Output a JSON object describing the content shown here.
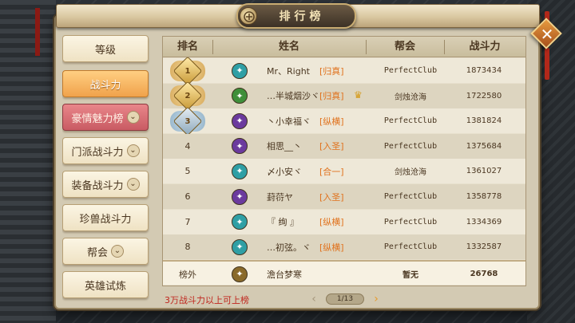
{
  "title": "排行榜",
  "tabs": [
    {
      "label": "等级",
      "state": "normal",
      "has_dropdown": false
    },
    {
      "label": "战斗力",
      "state": "active",
      "has_dropdown": false
    },
    {
      "label": "豪情魅力榜",
      "state": "sub",
      "has_dropdown": true
    },
    {
      "label": "门派战斗力",
      "state": "normal",
      "has_dropdown": true
    },
    {
      "label": "装备战斗力",
      "state": "normal",
      "has_dropdown": true
    },
    {
      "label": "珍兽战斗力",
      "state": "normal",
      "has_dropdown": false
    },
    {
      "label": "帮会",
      "state": "normal",
      "has_dropdown": true
    },
    {
      "label": "英雄试炼",
      "state": "normal",
      "has_dropdown": false
    }
  ],
  "columns": [
    "排名",
    "姓名",
    "帮会",
    "战斗力"
  ],
  "rows": [
    {
      "rank": "1",
      "medal": "gold",
      "icon": "teal",
      "name": "Mr、Right",
      "tag": "[归真]",
      "guild": "PerfectClub",
      "power": "1873434"
    },
    {
      "rank": "2",
      "medal": "gold",
      "icon": "green",
      "name": "…半城烟沙ヾ",
      "tag": "[归真]",
      "guild": "剑烛沧海",
      "power": "1722580",
      "crown": true
    },
    {
      "rank": "3",
      "medal": "silver",
      "icon": "purple",
      "name": "丶小幸福ヾ",
      "tag": "[纵横]",
      "guild": "PerfectClub",
      "power": "1381824"
    },
    {
      "rank": "4",
      "icon": "purple",
      "name": "相思__丶",
      "tag": "[入圣]",
      "guild": "PerfectClub",
      "power": "1375684"
    },
    {
      "rank": "5",
      "icon": "teal",
      "name": "〆小安ヾ",
      "tag": "[合一]",
      "guild": "剑烛沧海",
      "power": "1361027"
    },
    {
      "rank": "6",
      "icon": "purple",
      "name": "葑葕ヤ",
      "tag": "[入圣]",
      "guild": "PerfectClub",
      "power": "1358778"
    },
    {
      "rank": "7",
      "icon": "teal",
      "name": "『 绚 』",
      "tag": "[纵横]",
      "guild": "PerfectClub",
      "power": "1334369"
    },
    {
      "rank": "8",
      "icon": "teal",
      "name": "…初弦。ヾ",
      "tag": "[纵横]",
      "guild": "PerfectClub",
      "power": "1332587"
    }
  ],
  "my_row": {
    "rank": "榜外",
    "icon": "gold",
    "name": "澹台梦寒",
    "guild": "暂无",
    "power": "26768"
  },
  "footer_note": "3万战斗力以上可上榜",
  "pager": {
    "prev": "‹",
    "text": "1/13",
    "next": "›"
  },
  "close_label": "✕",
  "icon_colors": {
    "teal": "#2f9fa5",
    "green": "#3f8f3a",
    "purple": "#6b3a9e",
    "gold": "#8a6a2a"
  }
}
